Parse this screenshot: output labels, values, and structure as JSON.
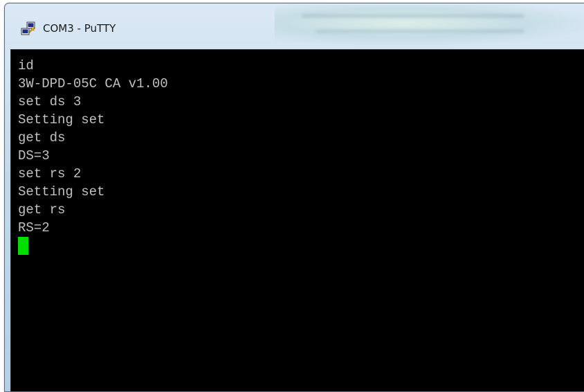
{
  "window": {
    "title": "COM3 - PuTTY",
    "icon": "putty-icon"
  },
  "terminal": {
    "lines": [
      "id",
      "3W-DPD-05C CA v1.00",
      "set ds 3",
      "Setting set",
      "get ds",
      "DS=3",
      "set rs 2",
      "Setting set",
      "get rs",
      "RS=2"
    ],
    "text_color": "#c0c0c0",
    "background_color": "#000000",
    "cursor_color": "#00e000"
  }
}
